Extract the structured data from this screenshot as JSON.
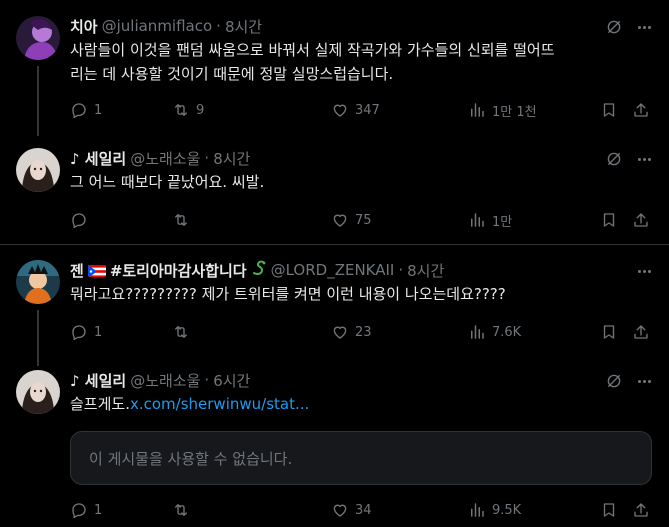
{
  "tweets": [
    {
      "name": "치아",
      "handle": "@julianmiflaco",
      "time": "8시간",
      "text_line1": "사람들이 이것을 팬덤 싸움으로 바꿔서 실제 작곡가와 가수들의 신뢰를 떨어뜨",
      "text_line2": "리는 데 사용할 것이기 때문에 정말 실망스럽습니다.",
      "replies": "1",
      "retweets": "9",
      "likes": "347",
      "views": "1만 1천"
    },
    {
      "name": "♪ 세일리",
      "handle": "@노래소울",
      "time": "8시간",
      "text": "그 어느 때보다 끝났어요. 씨발.",
      "replies": "",
      "retweets": "",
      "likes": "75",
      "views": "1만"
    },
    {
      "name_prefix": "젠",
      "name_suffix": "#토리아마감사합니다",
      "handle": "@LORD_ZENKAII",
      "time": "8시간",
      "text": "뭐라고요????????? 제가 트위터를 켜면 이런 내용이 나오는데요????",
      "replies": "1",
      "retweets": "",
      "likes": "23",
      "views": "7.6K"
    },
    {
      "name": "♪ 세일리",
      "handle": "@노래소울",
      "time": "6시간",
      "text": "슬프게도.",
      "link": "x.com/sherwinwu/stat...",
      "unavailable": "이 게시물을 사용할 수 없습니다.",
      "replies": "1",
      "retweets": "",
      "likes": "34",
      "views": "9.5K"
    }
  ],
  "separator": "·",
  "colors": {
    "background": "#000000",
    "text": "#e7e9ea",
    "muted": "#71767b",
    "link": "#1d9bf0",
    "divider": "#2f3336"
  },
  "icons": [
    "reply-icon",
    "retweet-icon",
    "like-icon",
    "views-icon",
    "bookmark-icon",
    "share-icon",
    "grok-icon",
    "more-icon"
  ]
}
